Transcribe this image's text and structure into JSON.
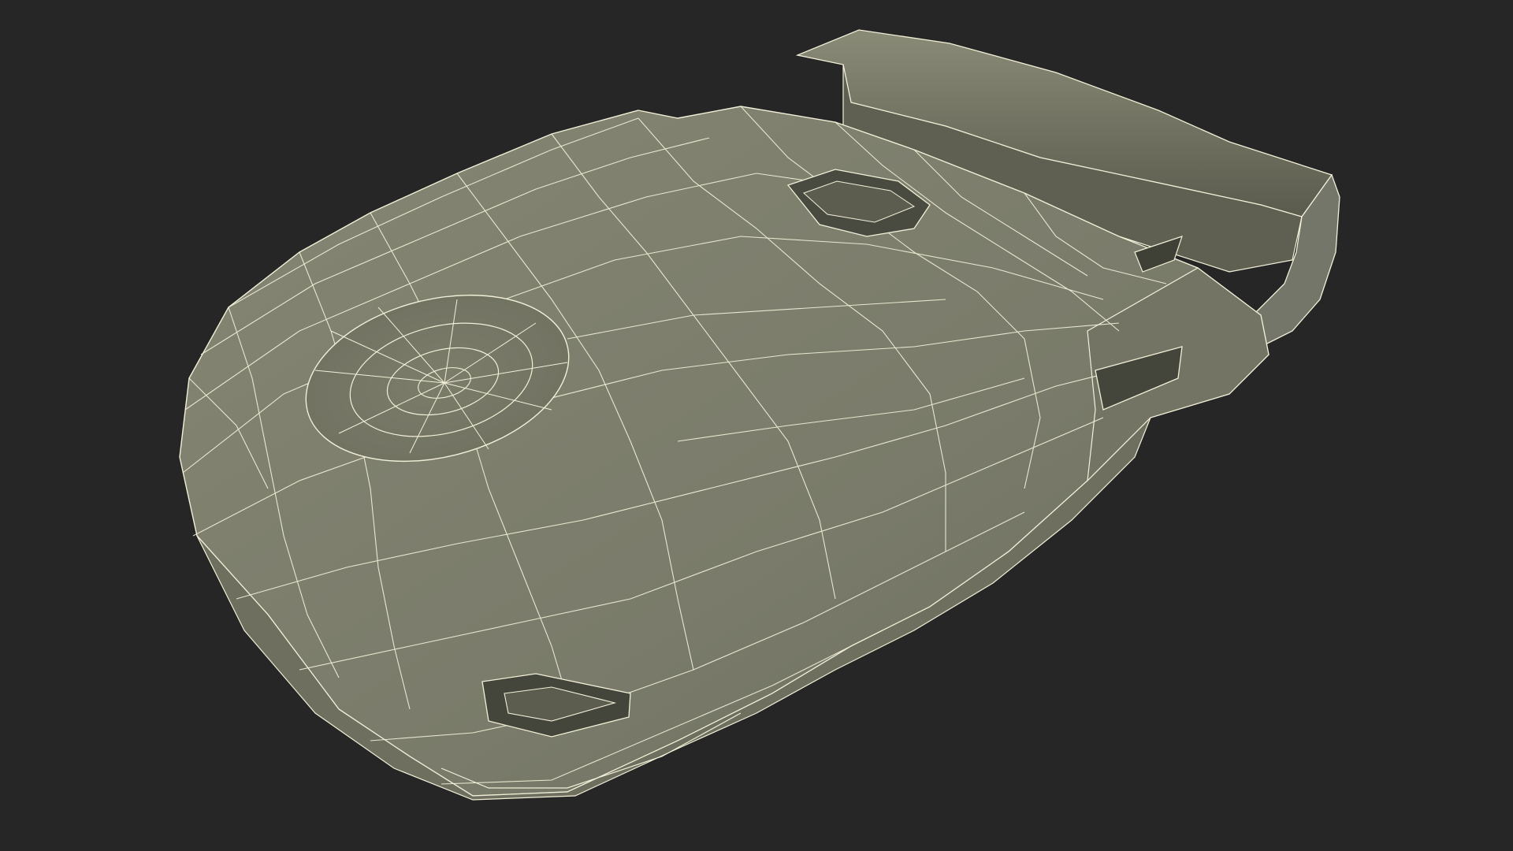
{
  "scene": {
    "subject": "wireframe-3d-model",
    "render_style": "polygon-wireframe",
    "colors": {
      "background": "#262626",
      "surface_base": "#7a7b6a",
      "surface_light": "#858673",
      "surface_shadow": "#5a5b4d",
      "recess_dark": "#45463b",
      "wire": "#f2f0d8"
    }
  }
}
